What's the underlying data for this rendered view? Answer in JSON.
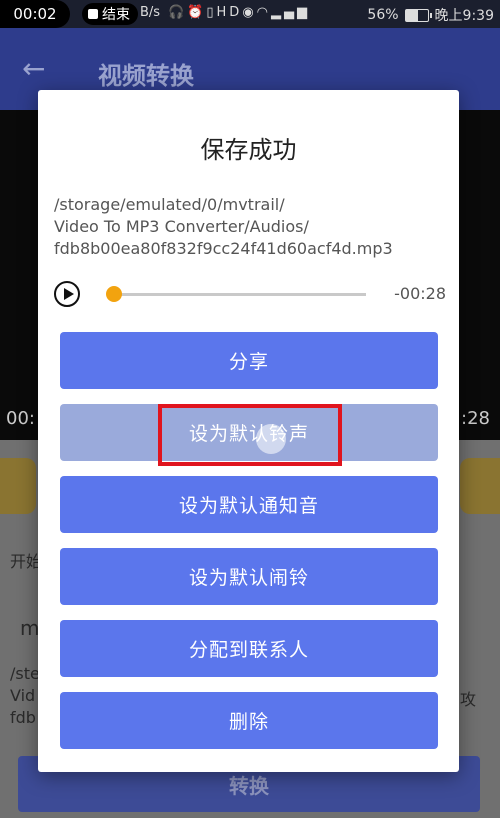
{
  "status_bar": {
    "time": "00:02",
    "recording_label": "结束",
    "speed": "B/s",
    "icons": [
      "headset-icon",
      "alarm-icon",
      "vibrate-icon",
      "hd-icon",
      "eye-icon",
      "wifi-icon",
      "signal-icon",
      "4g-signal-icon"
    ],
    "battery": "56%",
    "battery_level": 0.56,
    "clock": "晚上9:39"
  },
  "app_bar": {
    "title": "视频转换"
  },
  "background": {
    "time_left": "00:",
    "time_right": ":28",
    "start_label": "开始",
    "input_prefix": "m",
    "path_lines": [
      "/ste",
      "Vid",
      "fdb"
    ],
    "path_suffix": "攻",
    "convert_label": "转换"
  },
  "dialog": {
    "title": "保存成功",
    "path_lines": [
      "/storage/emulated/0/mvtrail/",
      "Video To MP3 Converter/Audios/",
      "fdb8b00ea80f832f9cc24f41d60acf4d.mp3"
    ],
    "player": {
      "remaining_time": "-00:28",
      "progress": 0.0
    },
    "buttons": [
      {
        "label": "分享"
      },
      {
        "label": "设为默认铃声"
      },
      {
        "label": "设为默认通知音"
      },
      {
        "label": "设为默认闹铃"
      },
      {
        "label": "分配到联系人"
      },
      {
        "label": "删除"
      }
    ]
  },
  "colors": {
    "button": "#5b76ec",
    "button_pressed": "#9aaadb",
    "slider_thumb": "#f2a30f",
    "highlight": "#e0141e",
    "app_bar": "#2e3c8c"
  }
}
